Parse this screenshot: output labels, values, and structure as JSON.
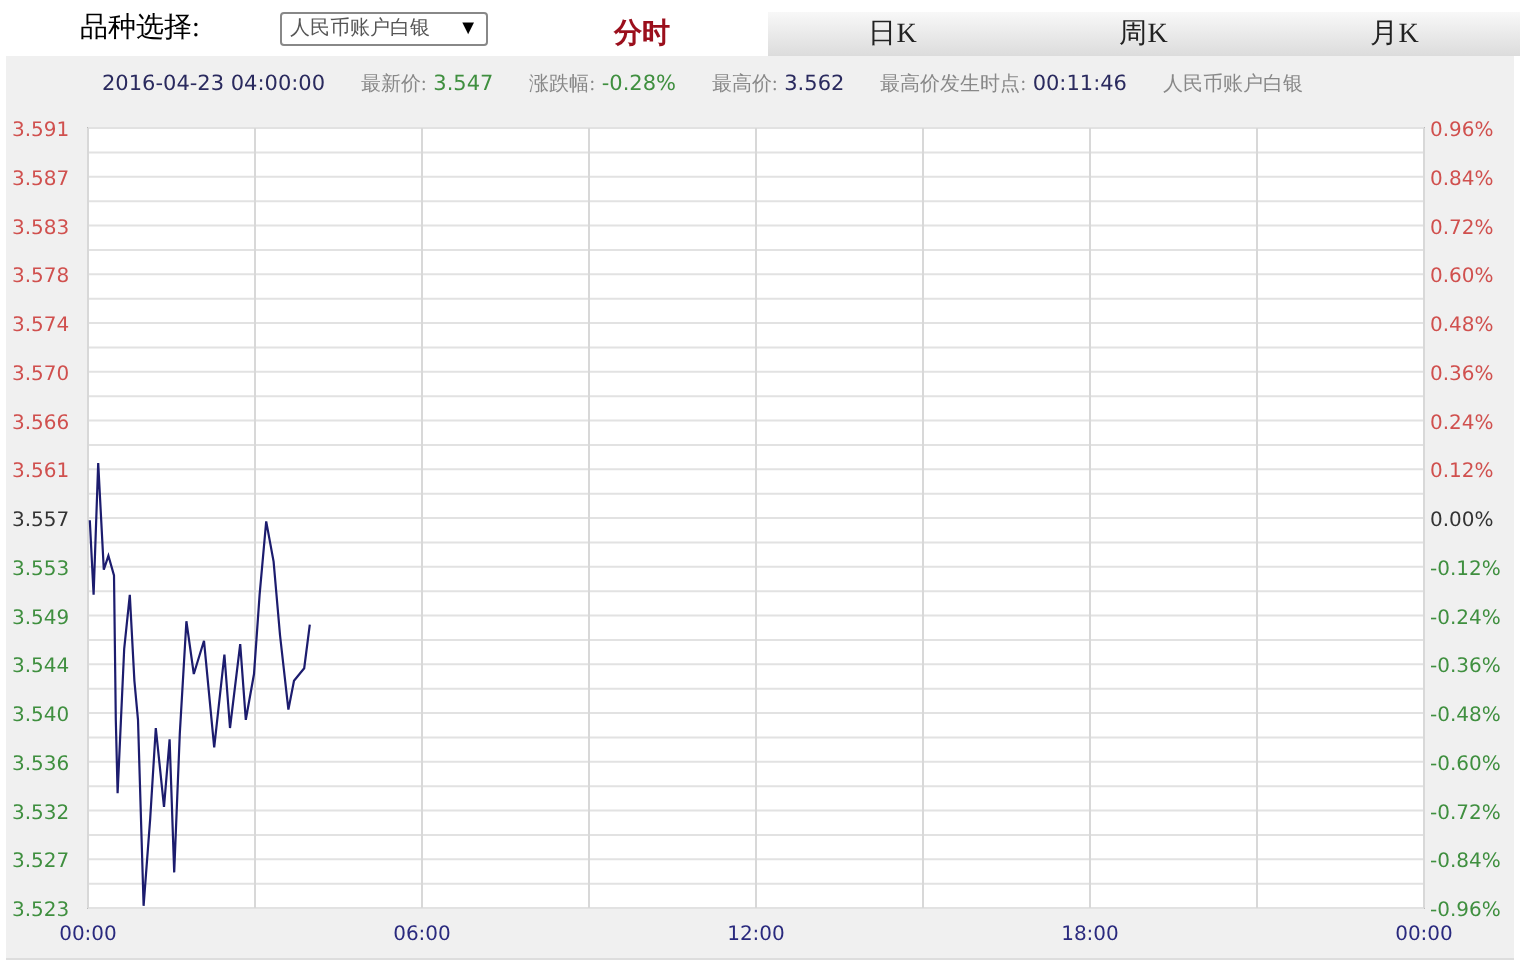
{
  "selector": {
    "label": "品种选择:",
    "value": "人民币账户白银",
    "arrow": "▼"
  },
  "tabs": [
    {
      "label": "分时",
      "selected": true
    },
    {
      "label": "日K",
      "selected": false
    },
    {
      "label": "周K",
      "selected": false
    },
    {
      "label": "月K",
      "selected": false
    }
  ],
  "info_bar": {
    "timestamp": "2016-04-23 04:00:00",
    "items": [
      {
        "label": "最新价:",
        "value": "3.547",
        "color": "#3f8f3f"
      },
      {
        "label": "涨跌幅:",
        "value": "-0.28%",
        "color": "#3f8f3f"
      },
      {
        "label": "最高价:",
        "value": "3.562",
        "color": "#2a2a5e"
      },
      {
        "label": "最高价发生时点:",
        "value": "00:11:46",
        "color": "#2a2a5e"
      }
    ],
    "instrument": "人民币账户白银"
  },
  "chart": {
    "next_day_label": "00:00",
    "percent_axis": [
      {
        "label": "0.96%",
        "color": "#d0504e"
      },
      {
        "label": "0.84%",
        "color": "#d0504e"
      },
      {
        "label": "0.72%",
        "color": "#d0504e"
      },
      {
        "label": "0.60%",
        "color": "#d0504e"
      },
      {
        "label": "0.48%",
        "color": "#d0504e"
      },
      {
        "label": "0.36%",
        "color": "#d0504e"
      },
      {
        "label": "0.24%",
        "color": "#d0504e"
      },
      {
        "label": "0.12%",
        "color": "#d0504e"
      },
      {
        "label": "0.00%",
        "color": "#333333"
      },
      {
        "label": "-0.12%",
        "color": "#3f8f3f"
      },
      {
        "label": "-0.24%",
        "color": "#3f8f3f"
      },
      {
        "label": "-0.36%",
        "color": "#3f8f3f"
      },
      {
        "label": "-0.48%",
        "color": "#3f8f3f"
      },
      {
        "label": "-0.60%",
        "color": "#3f8f3f"
      },
      {
        "label": "-0.72%",
        "color": "#3f8f3f"
      },
      {
        "label": "-0.84%",
        "color": "#3f8f3f"
      },
      {
        "label": "-0.96%",
        "color": "#3f8f3f"
      }
    ],
    "chart_data": {
      "type": "line",
      "xlim": [
        0,
        1440
      ],
      "ylim": [
        3.523,
        3.591
      ],
      "xticks": [
        {
          "value": 0,
          "label": "00:00"
        },
        {
          "value": 360,
          "label": "06:00"
        },
        {
          "value": 720,
          "label": "12:00"
        },
        {
          "value": 1080,
          "label": "18:00"
        }
      ],
      "yticks": [
        {
          "value": 3.591,
          "label": "3.591"
        },
        {
          "value": 3.58675,
          "label": "3.587"
        },
        {
          "value": 3.5825,
          "label": "3.583"
        },
        {
          "value": 3.57825,
          "label": "3.578"
        },
        {
          "value": 3.574,
          "label": "3.574"
        },
        {
          "value": 3.56975,
          "label": "3.570"
        },
        {
          "value": 3.5655,
          "label": "3.566"
        },
        {
          "value": 3.56125,
          "label": "3.561"
        },
        {
          "value": 3.557,
          "label": "3.557"
        },
        {
          "value": 3.55275,
          "label": "3.553"
        },
        {
          "value": 3.5485,
          "label": "3.549"
        },
        {
          "value": 3.54425,
          "label": "3.544"
        },
        {
          "value": 3.54,
          "label": "3.540"
        },
        {
          "value": 3.53575,
          "label": "3.536"
        },
        {
          "value": 3.5315,
          "label": "3.532"
        },
        {
          "value": 3.52725,
          "label": "3.527"
        },
        {
          "value": 3.523,
          "label": "3.523"
        }
      ],
      "x": [
        2,
        6,
        11,
        17,
        22,
        28,
        30,
        32,
        39,
        45,
        50,
        54,
        60,
        67,
        73,
        82,
        88,
        93,
        99,
        106,
        114,
        125,
        136,
        147,
        153,
        164,
        170,
        179,
        185,
        192,
        200,
        207,
        216,
        222,
        233,
        239
      ],
      "grid": true,
      "series": [
        {
          "color": "#1c1c6e",
          "values": [
            3.5568,
            3.5503,
            3.5618,
            3.5525,
            3.5537,
            3.552,
            3.5394,
            3.533,
            3.5456,
            3.5503,
            3.5428,
            3.5394,
            3.5232,
            3.5308,
            3.5387,
            3.5318,
            3.5377,
            3.5261,
            3.5382,
            3.548,
            3.5434,
            3.5463,
            3.537,
            3.5451,
            3.5387,
            3.546,
            3.5394,
            3.5434,
            3.5503,
            3.5567,
            3.5532,
            3.5468,
            3.5403,
            3.5428,
            3.5439,
            3.5477
          ]
        }
      ]
    }
  }
}
